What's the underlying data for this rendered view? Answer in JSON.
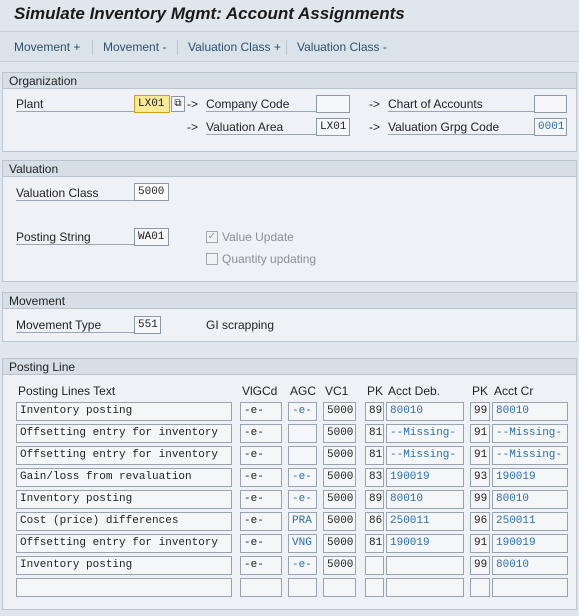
{
  "title": "Simulate Inventory Mgmt: Account Assignments",
  "toolbar": [
    "Movement +",
    "Movement -",
    "Valuation Class +",
    "Valuation Class -"
  ],
  "organization": {
    "header": "Organization",
    "plant_label": "Plant",
    "plant_value": "LX01",
    "company_code_label": "Company Code",
    "valuation_area_label": "Valuation Area",
    "valuation_area_value": "LX01",
    "chart_of_accounts_label": "Chart of Accounts",
    "valuation_grpg_code_label": "Valuation Grpg Code",
    "valuation_grpg_code_value": "0001",
    "arrow": "->"
  },
  "valuation": {
    "header": "Valuation",
    "valuation_class_label": "Valuation Class",
    "valuation_class_value": "5000",
    "posting_string_label": "Posting String",
    "posting_string_value": "WA01",
    "value_update_label": "Value Update",
    "quantity_updating_label": "Quantity updating"
  },
  "movement": {
    "header": "Movement",
    "movement_type_label": "Movement Type",
    "movement_type_value": "551",
    "movement_type_text": "GI scrapping"
  },
  "posting_line": {
    "header": "Posting Line",
    "columns": [
      "Posting Lines Text",
      "VlGCd",
      "AGC",
      "VC1",
      "PK",
      "Acct Deb.",
      "PK",
      "Acct Cr"
    ],
    "rows": [
      {
        "text": "Inventory posting",
        "vlgcd": "-e-",
        "agc": "-e-",
        "vc1": "5000",
        "pk_deb": "89",
        "acct_deb": "80010",
        "pk_cr": "99",
        "acct_cr": "80010"
      },
      {
        "text": "Offsetting entry for inventory",
        "vlgcd": "-e-",
        "agc": "",
        "vc1": "5000",
        "pk_deb": "81",
        "acct_deb": "--Missing-",
        "pk_cr": "91",
        "acct_cr": "--Missing-"
      },
      {
        "text": "Offsetting entry for inventory",
        "vlgcd": "-e-",
        "agc": "",
        "vc1": "5000",
        "pk_deb": "81",
        "acct_deb": "--Missing-",
        "pk_cr": "91",
        "acct_cr": "--Missing-"
      },
      {
        "text": "Gain/loss from revaluation",
        "vlgcd": "-e-",
        "agc": "-e-",
        "vc1": "5000",
        "pk_deb": "83",
        "acct_deb": "190019",
        "pk_cr": "93",
        "acct_cr": "190019"
      },
      {
        "text": "Inventory posting",
        "vlgcd": "-e-",
        "agc": "-e-",
        "vc1": "5000",
        "pk_deb": "89",
        "acct_deb": "80010",
        "pk_cr": "99",
        "acct_cr": "80010"
      },
      {
        "text": "Cost (price) differences",
        "vlgcd": "-e-",
        "agc": "PRA",
        "vc1": "5000",
        "pk_deb": "86",
        "acct_deb": "250011",
        "pk_cr": "96",
        "acct_cr": "250011"
      },
      {
        "text": "Offsetting entry for inventory",
        "vlgcd": "-e-",
        "agc": "VNG",
        "vc1": "5000",
        "pk_deb": "81",
        "acct_deb": "190019",
        "pk_cr": "91",
        "acct_cr": "190019"
      },
      {
        "text": "Inventory posting",
        "vlgcd": "-e-",
        "agc": "-e-",
        "vc1": "5000",
        "pk_deb": "",
        "acct_deb": "",
        "pk_cr": "99",
        "acct_cr": "80010"
      },
      {
        "text": "",
        "vlgcd": "",
        "agc": "",
        "vc1": "",
        "pk_deb": "",
        "acct_deb": "",
        "pk_cr": "",
        "acct_cr": ""
      }
    ]
  }
}
